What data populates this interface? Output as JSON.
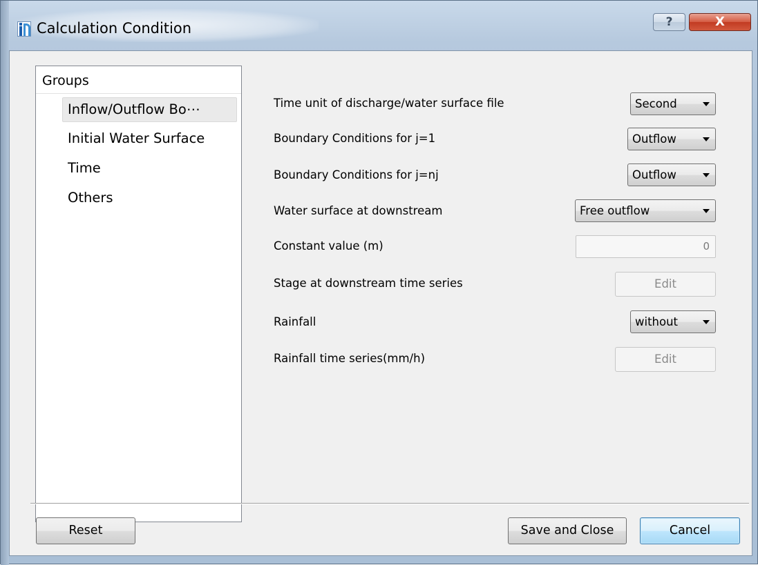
{
  "window": {
    "title": "Calculation Condition",
    "help_label": "?",
    "close_label": "X"
  },
  "groups": {
    "header": "Groups",
    "items": [
      {
        "label": "Inflow/Outflow Bo⋯",
        "selected": true
      },
      {
        "label": "Initial Water Surface",
        "selected": false
      },
      {
        "label": "Time",
        "selected": false
      },
      {
        "label": "Others",
        "selected": false
      }
    ]
  },
  "settings": {
    "time_unit": {
      "label": "Time unit of discharge/water surface file",
      "value": "Second"
    },
    "bc_j1": {
      "label": "Boundary Conditions for j=1",
      "value": "Outflow"
    },
    "bc_jnj": {
      "label": "Boundary Conditions for j=nj",
      "value": "Outflow"
    },
    "water_surface_downstream": {
      "label": "Water surface at downstream",
      "value": "Free outflow"
    },
    "constant_value": {
      "label": "Constant value (m)",
      "value": "0",
      "enabled": false
    },
    "stage_time_series": {
      "label": "Stage at downstream time series",
      "button": "Edit",
      "enabled": false
    },
    "rainfall": {
      "label": "Rainfall",
      "value": "without"
    },
    "rainfall_time_series": {
      "label": "Rainfall time series(mm/h)",
      "button": "Edit",
      "enabled": false
    }
  },
  "buttons": {
    "reset": "Reset",
    "save_close": "Save and Close",
    "cancel": "Cancel"
  },
  "colors": {
    "window_frame": "#aec3d9",
    "client_bg": "#f0f0f0",
    "close_button": "#c23b22",
    "default_button": "#bee6fd"
  }
}
